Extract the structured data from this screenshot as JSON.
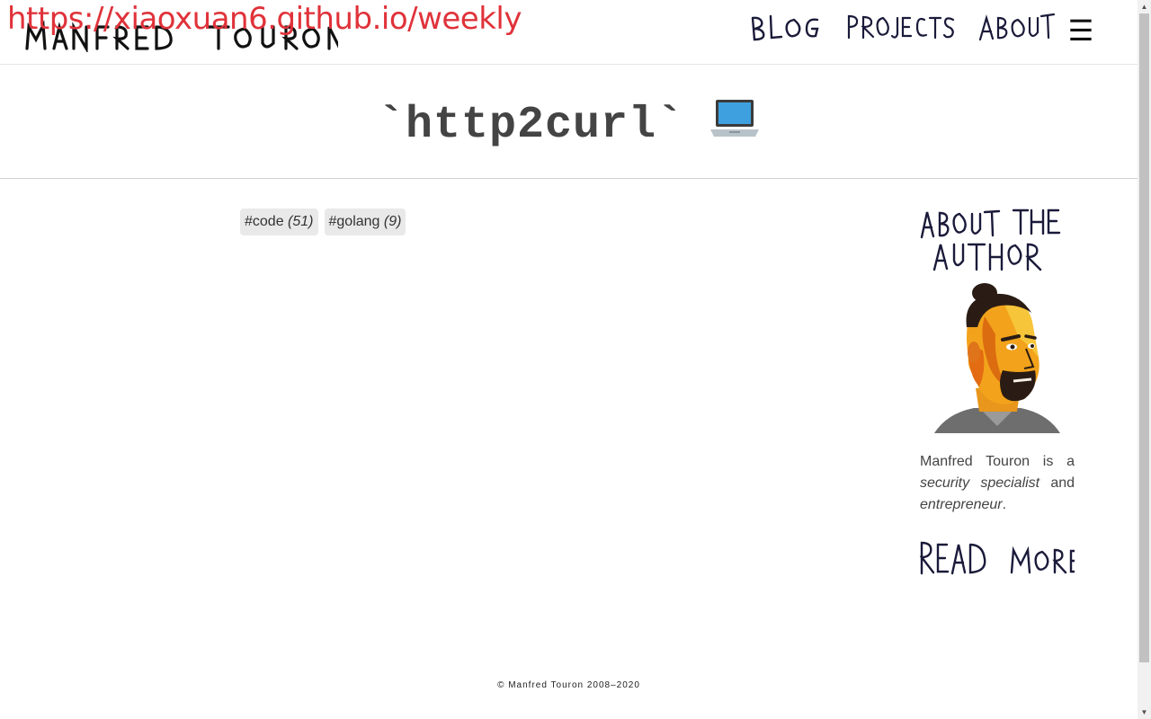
{
  "browser": {
    "url_overlay": "https://xiaoxuan6.github.io/weekly"
  },
  "header": {
    "logo_text": "MANFRED TOURON",
    "nav": [
      {
        "label": "BLOG"
      },
      {
        "label": "PROJECTS"
      },
      {
        "label": "ABOUT"
      }
    ],
    "menu_icon": "hamburger-icon",
    "menu_glyph": "☰"
  },
  "page": {
    "title": "`http2curl`",
    "title_emoji": "💻"
  },
  "tags": [
    {
      "name": "#code",
      "count": "(51)"
    },
    {
      "name": "#golang",
      "count": "(9)"
    }
  ],
  "sidebar": {
    "heading": "ABOUT THE AUTHOR",
    "bio_prefix": "Manfred Touron is a ",
    "bio_role": "security specialist",
    "bio_and": " and ",
    "bio_role2": "entrepreneur",
    "bio_suffix": ".",
    "read_more": "READ MORE"
  },
  "footer": {
    "copyright": "© Manfred Touron 2008–2020"
  },
  "colors": {
    "overlay_red": "#e0323a",
    "ink": "#1a1a3a",
    "tag_bg": "#e9e9e9"
  }
}
